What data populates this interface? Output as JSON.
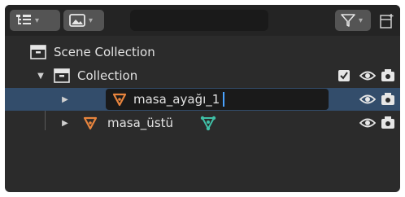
{
  "header": {
    "display_mode_icon": "outliner-list-icon",
    "filter_mode_icon": "image-icon",
    "search": {
      "placeholder": "",
      "value": ""
    },
    "filter_icon": "funnel-icon",
    "new_collection_icon": "new-collection-icon"
  },
  "outliner": {
    "rows": [
      {
        "label": "Scene Collection",
        "icon": "scene-collection-icon"
      },
      {
        "label": "Collection",
        "icon": "collection-icon"
      },
      {
        "label": "masa_ayağı_1",
        "icon": "mesh-object-icon",
        "selected": true,
        "editing": true
      },
      {
        "label": "masa_üstü",
        "icon": "mesh-object-icon",
        "modifier_icon": "vertex-group-icon"
      }
    ]
  },
  "colors": {
    "background": "#2b2b2b",
    "header": "#242424",
    "selection": "#334d6b",
    "object_icon": "#e8843d",
    "modifier_icon": "#3fbfa6",
    "text": "#e2e2e2"
  }
}
